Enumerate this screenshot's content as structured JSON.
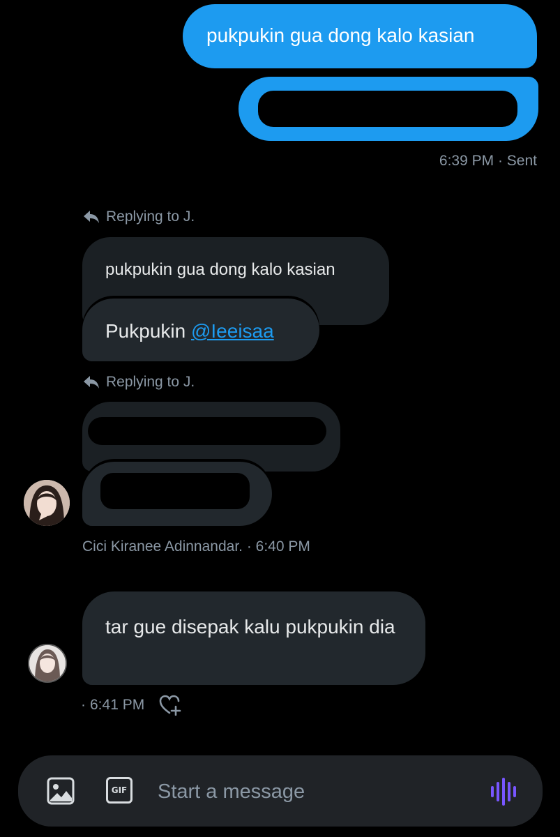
{
  "sent": {
    "message1": "pukpukin gua dong kalo kasian",
    "meta": "6:39 PM · Sent"
  },
  "thread1": {
    "reply_label": "Replying to J.",
    "quoted_text": "pukpukin gua dong kalo kasian",
    "message_prefix": "Pukpukin ",
    "mention": "@Ieeisaa"
  },
  "thread2": {
    "reply_label": "Replying to J.",
    "sender_meta": "Cici Kiranee Adinnandar. · 6:40 PM"
  },
  "last": {
    "message": "tar gue disepak kalu pukpukin dia",
    "meta_prefix": "·",
    "time": "6:41 PM"
  },
  "composer": {
    "placeholder": "Start a message",
    "gif_label": "GIF"
  },
  "icons": {
    "reply": "reply-arrow-icon",
    "image": "image-icon",
    "gif": "gif-icon",
    "voice": "voice-waveform-icon",
    "react": "heart-plus-icon"
  },
  "colors": {
    "accent": "#1d9bf0",
    "voice": "#7856ff"
  }
}
